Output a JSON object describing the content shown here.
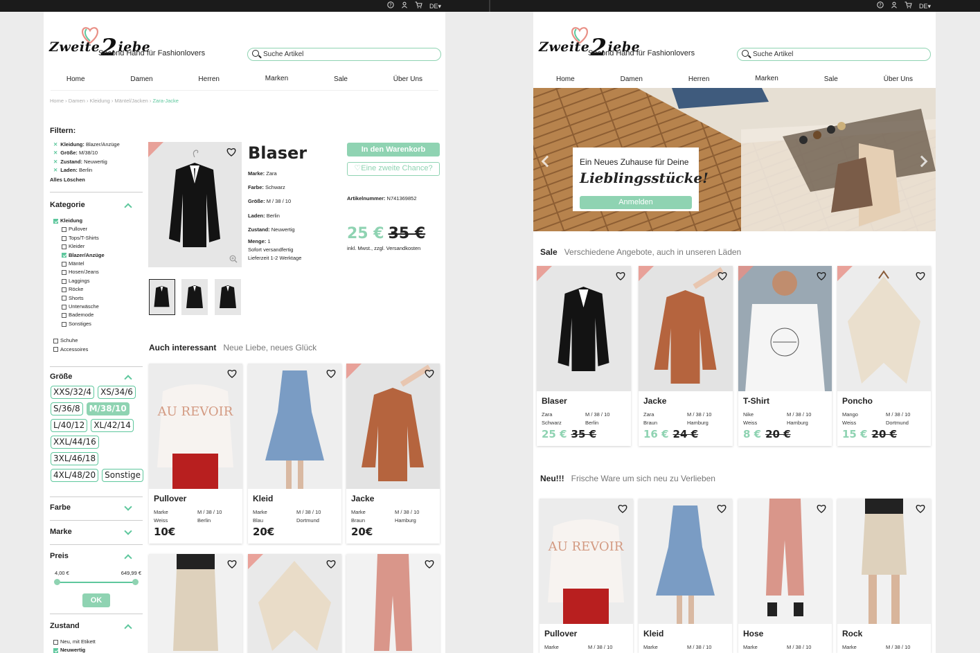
{
  "topbar": {
    "lang": "DE"
  },
  "brand": {
    "logo": "Zweite Liebe",
    "logo_left": "Zweite",
    "logo_digit": "2",
    "logo_right": "iebe",
    "tagline": "Second Hand für Fashionlovers"
  },
  "search": {
    "placeholder": "Suche Artikel"
  },
  "nav": [
    "Home",
    "Damen",
    "Herren",
    "Marken",
    "Sale",
    "Über Uns"
  ],
  "product_page": {
    "breadcrumb": [
      "Home",
      "Damen",
      "Kleidung",
      "Mäntel/Jacken",
      "Zara-Jacke"
    ],
    "filters": {
      "title": "Filtern:",
      "active": [
        {
          "key": "Kleidung:",
          "value": "Blazer/Anzüge"
        },
        {
          "key": "Größe:",
          "value": "M/38/10"
        },
        {
          "key": "Zustand:",
          "value": "Neuwertig"
        },
        {
          "key": "Laden:",
          "value": "Berlin"
        }
      ],
      "clear_all": "Alles Löschen",
      "category": {
        "title": "Kategorie",
        "main": "Kleidung",
        "items": [
          "Pullover",
          "Tops/T-Shirts",
          "Kleider",
          "Blazer/Anzüge",
          "Mäntel",
          "Hosen/Jeans",
          "Laggings",
          "Röcke",
          "Shorts",
          "Unterwäsche",
          "Bademode",
          "Sonstiges"
        ],
        "checked_item": "Blazer/Anzüge",
        "others": [
          "Schuhe",
          "Accessoires"
        ]
      },
      "size": {
        "title": "Größe",
        "chips": [
          "XXS/32/4",
          "XS/34/6",
          "S/36/8",
          "M/38/10",
          "L/40/12",
          "XL/42/14",
          "XXL/44/16",
          "3XL/46/18",
          "4XL/48/20",
          "Sonstige"
        ],
        "selected": "M/38/10"
      },
      "color_title": "Farbe",
      "brand_title": "Marke",
      "price": {
        "title": "Preis",
        "min": "4,00 €",
        "max": "649,99 €",
        "ok": "OK"
      },
      "condition": {
        "title": "Zustand",
        "items": [
          "Neu, mit Etikett",
          "Neuwertig"
        ],
        "checked": "Neuwertig"
      }
    },
    "product": {
      "title": "Blaser",
      "brand_label": "Marke:",
      "brand": "Zara",
      "color_label": "Farbe:",
      "color": "Schwarz",
      "size_label": "Größe:",
      "size": "M / 38 / 10",
      "store_label": "Laden:",
      "store": "Berlin",
      "condition_label": "Zustand:",
      "condition": "Neuwertig",
      "qty_label": "Menge:",
      "qty": "1",
      "shipping": "Sofort versandfertig",
      "delivery": "Lieferzeit 1-2 Werktage",
      "cart_button": "In den Warenkorb",
      "chance_button": "♡Eine zweite Chance?",
      "artnr_label": "Artikelnummer:",
      "artnr": "N741369852",
      "price": "25 €",
      "old_price": "35 €",
      "vat": "inkl. Mwst., zzgl. Versandkosten"
    },
    "related": {
      "title": "Auch interessant",
      "subtitle": "Neue Liebe, neues Glück",
      "items": [
        {
          "name": "Pullover",
          "brand_label": "Marke",
          "color": "Weiss",
          "size": "M / 38 / 10",
          "store": "Berlin",
          "price": "10€"
        },
        {
          "name": "Kleid",
          "brand_label": "Marke",
          "color": "Blau",
          "size": "M / 38 / 10",
          "store": "Dortmund",
          "price": "20€"
        },
        {
          "name": "Jacke",
          "brand_label": "Marke",
          "color": "Braun",
          "size": "M / 38 / 10",
          "store": "Hamburg",
          "price": "20€"
        }
      ]
    }
  },
  "home_page": {
    "hero": {
      "line1": "Ein Neues Zuhause für Deine",
      "line2": "Lieblingsstücke!",
      "button": "Anmelden"
    },
    "sale": {
      "title": "Sale",
      "subtitle": "Verschiedene Angebote, auch in unseren Läden",
      "items": [
        {
          "name": "Blaser",
          "brand": "Zara",
          "color": "Schwarz",
          "size": "M / 38 / 10",
          "store": "Berlin",
          "price": "25 €",
          "old_price": "35 €"
        },
        {
          "name": "Jacke",
          "brand": "Zara",
          "color": "Braun",
          "size": "M / 38 / 10",
          "store": "Hamburg",
          "price": "16 €",
          "old_price": "24 €"
        },
        {
          "name": "T-Shirt",
          "brand": "Nike",
          "color": "Weiss",
          "size": "M / 38 / 10",
          "store": "Hamburg",
          "price": "8 €",
          "old_price": "20 €"
        },
        {
          "name": "Poncho",
          "brand": "Mango",
          "color": "Weiss",
          "size": "M / 38 / 10",
          "store": "Dortmund",
          "price": "15 €",
          "old_price": "20 €"
        }
      ]
    },
    "new": {
      "title": "Neu!!!",
      "subtitle": "Frische Ware um sich neu zu Verlieben",
      "items": [
        {
          "name": "Pullover",
          "brand_label": "Marke",
          "size": "M / 38 / 10"
        },
        {
          "name": "Kleid",
          "brand_label": "Marke",
          "size": "M / 38 / 10"
        },
        {
          "name": "Hose",
          "brand_label": "Marke",
          "size": "M / 38 / 10"
        },
        {
          "name": "Rock",
          "brand_label": "Marke",
          "size": "M / 38 / 10"
        }
      ]
    }
  },
  "colors": {
    "accent": "#8fd3b2",
    "accent_dark": "#5ec79d",
    "corner": "#e99086",
    "topbar": "#1b1b1b"
  }
}
